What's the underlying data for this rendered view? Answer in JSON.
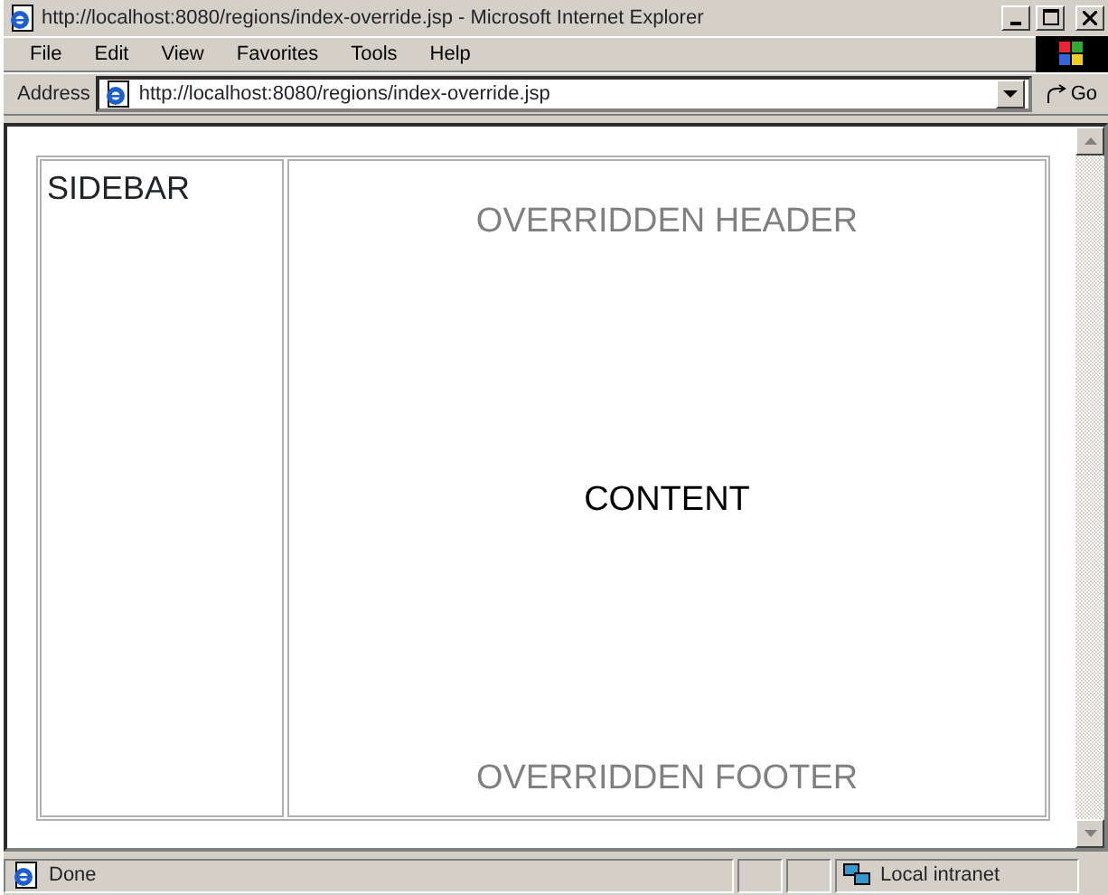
{
  "window": {
    "title": "http://localhost:8080/regions/index-override.jsp - Microsoft Internet Explorer"
  },
  "menu": [
    "File",
    "Edit",
    "View",
    "Favorites",
    "Tools",
    "Help"
  ],
  "address_bar": {
    "label": "Address",
    "value": "http://localhost:8080/regions/index-override.jsp",
    "go": "Go"
  },
  "page": {
    "sidebar": "SIDEBAR",
    "header": "OVERRIDDEN HEADER",
    "content": "CONTENT",
    "footer": "OVERRIDDEN FOOTER"
  },
  "status_bar": {
    "status": "Done",
    "zone": "Local intranet"
  }
}
